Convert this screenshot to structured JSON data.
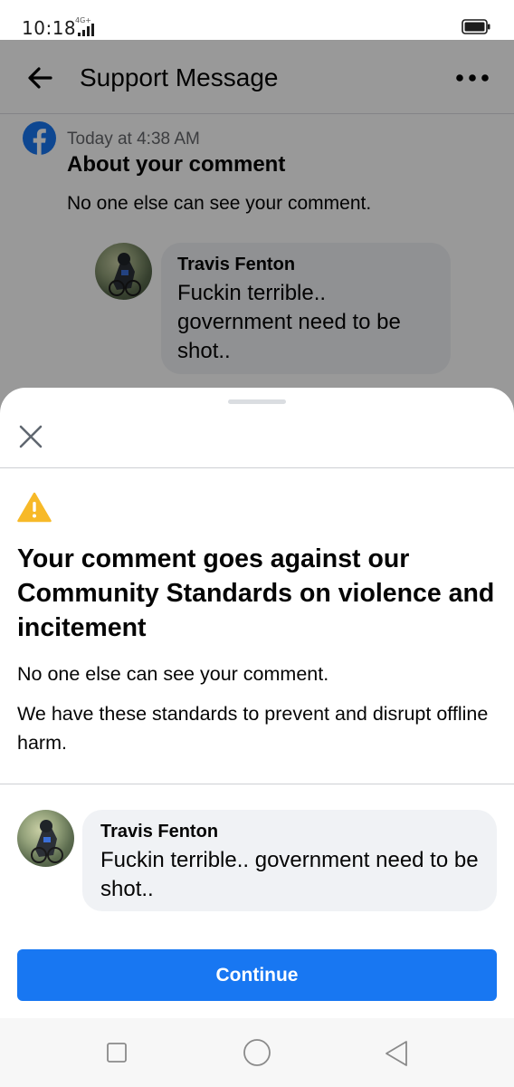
{
  "status_bar": {
    "time": "10:18",
    "network": "4G+"
  },
  "app_bar": {
    "title": "Support Message",
    "back_icon": "arrow-left-icon",
    "menu_icon": "more-horizontal-icon"
  },
  "message": {
    "timestamp": "Today at 4:38 AM",
    "title": "About your comment",
    "subtitle": "No one else can see your comment.",
    "comment": {
      "author": "Travis Fenton",
      "text": "Fuckin terrible.. government need to be shot.."
    }
  },
  "sheet": {
    "close_icon": "close-icon",
    "warning_icon": "warning-triangle-icon",
    "heading": "Your comment goes against our Community Standards on violence and incitement",
    "paragraph1": "No one else can see your comment.",
    "paragraph2": "We have these standards to prevent and disrupt offline harm.",
    "comment": {
      "author": "Travis Fenton",
      "text": "Fuckin terrible.. government need to be shot.."
    },
    "continue_label": "Continue"
  },
  "colors": {
    "brand_blue": "#1877f2",
    "warning_yellow": "#f7b928",
    "bubble_gray": "#f0f2f5",
    "secondary_text": "#65676b"
  },
  "nav_bar": {
    "icons": [
      "recent-apps-icon",
      "home-icon",
      "back-icon"
    ]
  }
}
